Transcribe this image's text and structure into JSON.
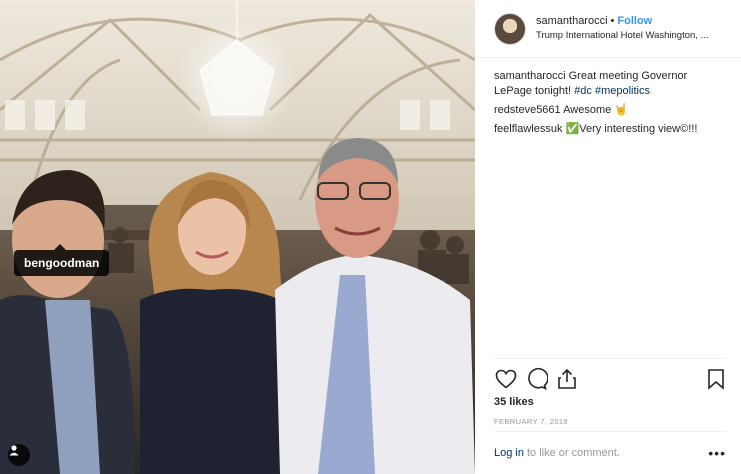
{
  "photo": {
    "tag_label": "bengoodman",
    "tag_toggle_icon": "person-icon"
  },
  "header": {
    "username": "samantharocci",
    "separator": "•",
    "follow_label": "Follow",
    "location": "Trump International Hotel Washington, ..."
  },
  "comments": [
    {
      "user": "samantharocci",
      "text": "Great meeting Governor LePage tonight!",
      "hashtags": [
        "#dc",
        "#mepolitics"
      ]
    },
    {
      "user": "redsteve5661",
      "text": "Awesome 🤘"
    },
    {
      "user": "feelflawlessuk",
      "text": "✅Very interesting view©!!!"
    }
  ],
  "actions": {
    "icons": [
      "heart-icon",
      "comment-icon",
      "share-icon",
      "bookmark-icon"
    ],
    "likes": "35 likes",
    "date": "FEBRUARY 7, 2018"
  },
  "footer": {
    "login_label": "Log in",
    "login_rest": "to like or comment.",
    "more_label": "•••"
  },
  "colors": {
    "link": "#003569",
    "follow": "#3897f0",
    "muted": "#999999",
    "border": "#efefef"
  }
}
